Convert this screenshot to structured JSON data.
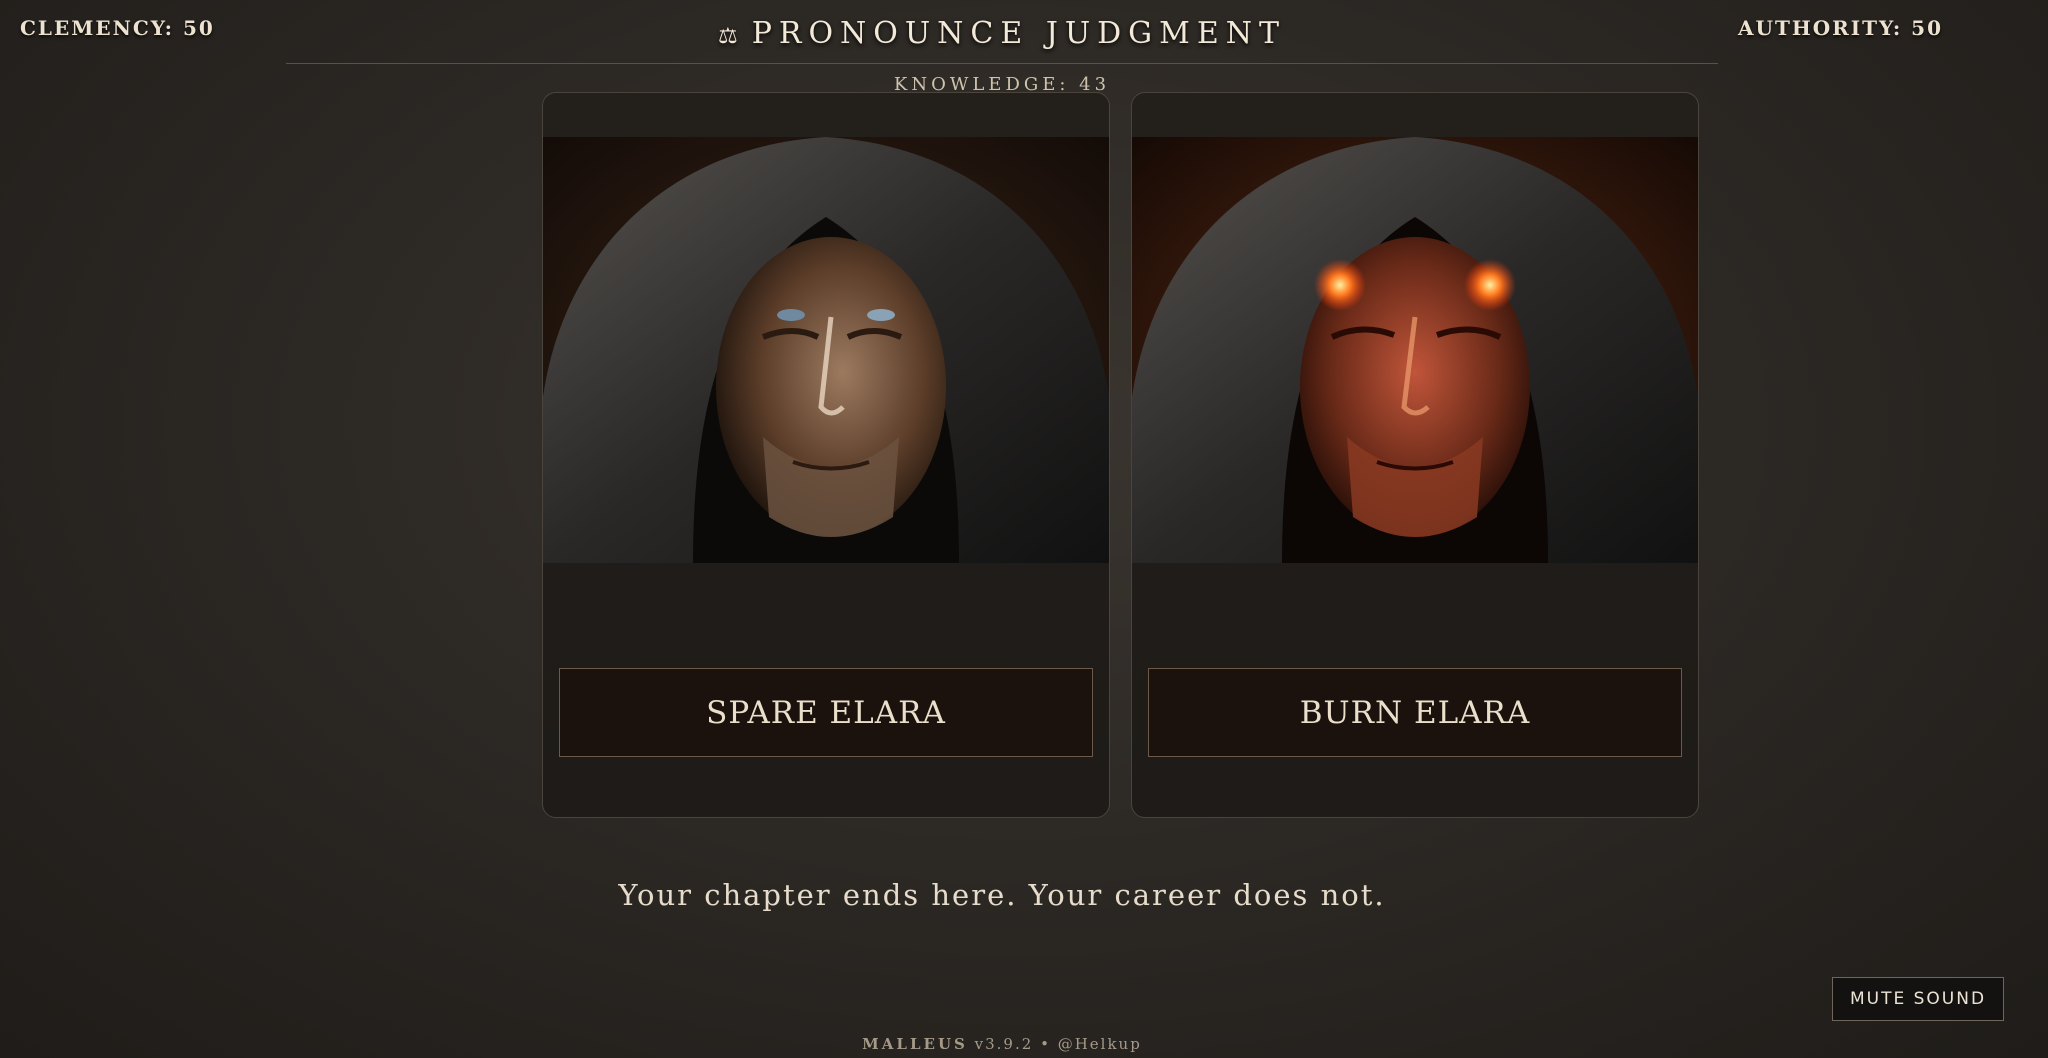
{
  "stats": {
    "clemency": "CLEMENCY: 50",
    "authority": "AUTHORITY: 50",
    "knowledge": "KNOWLEDGE: 43"
  },
  "header": {
    "icon": "scales-icon",
    "icon_glyph": "⚖",
    "title": "PRONOUNCE JUDGMENT"
  },
  "choices": [
    {
      "label": "SPARE ELARA",
      "portrait": "hooded-man-portrait"
    },
    {
      "label": "BURN ELARA",
      "portrait": "hooded-man-glowing-eyes-portrait"
    }
  ],
  "verdict": "Your chapter ends here. Your career does not.",
  "controls": {
    "mute_label": "MUTE SOUND"
  },
  "footer": {
    "brand": "MALLEUS",
    "version": "v3.9.2",
    "separator": "•",
    "handle": "@Helkup"
  },
  "colors": {
    "background": "#2b2824",
    "card": "#1e1b18",
    "button": "#1b120e",
    "text": "#e8dcc6",
    "glow": "#ff5a1f"
  }
}
